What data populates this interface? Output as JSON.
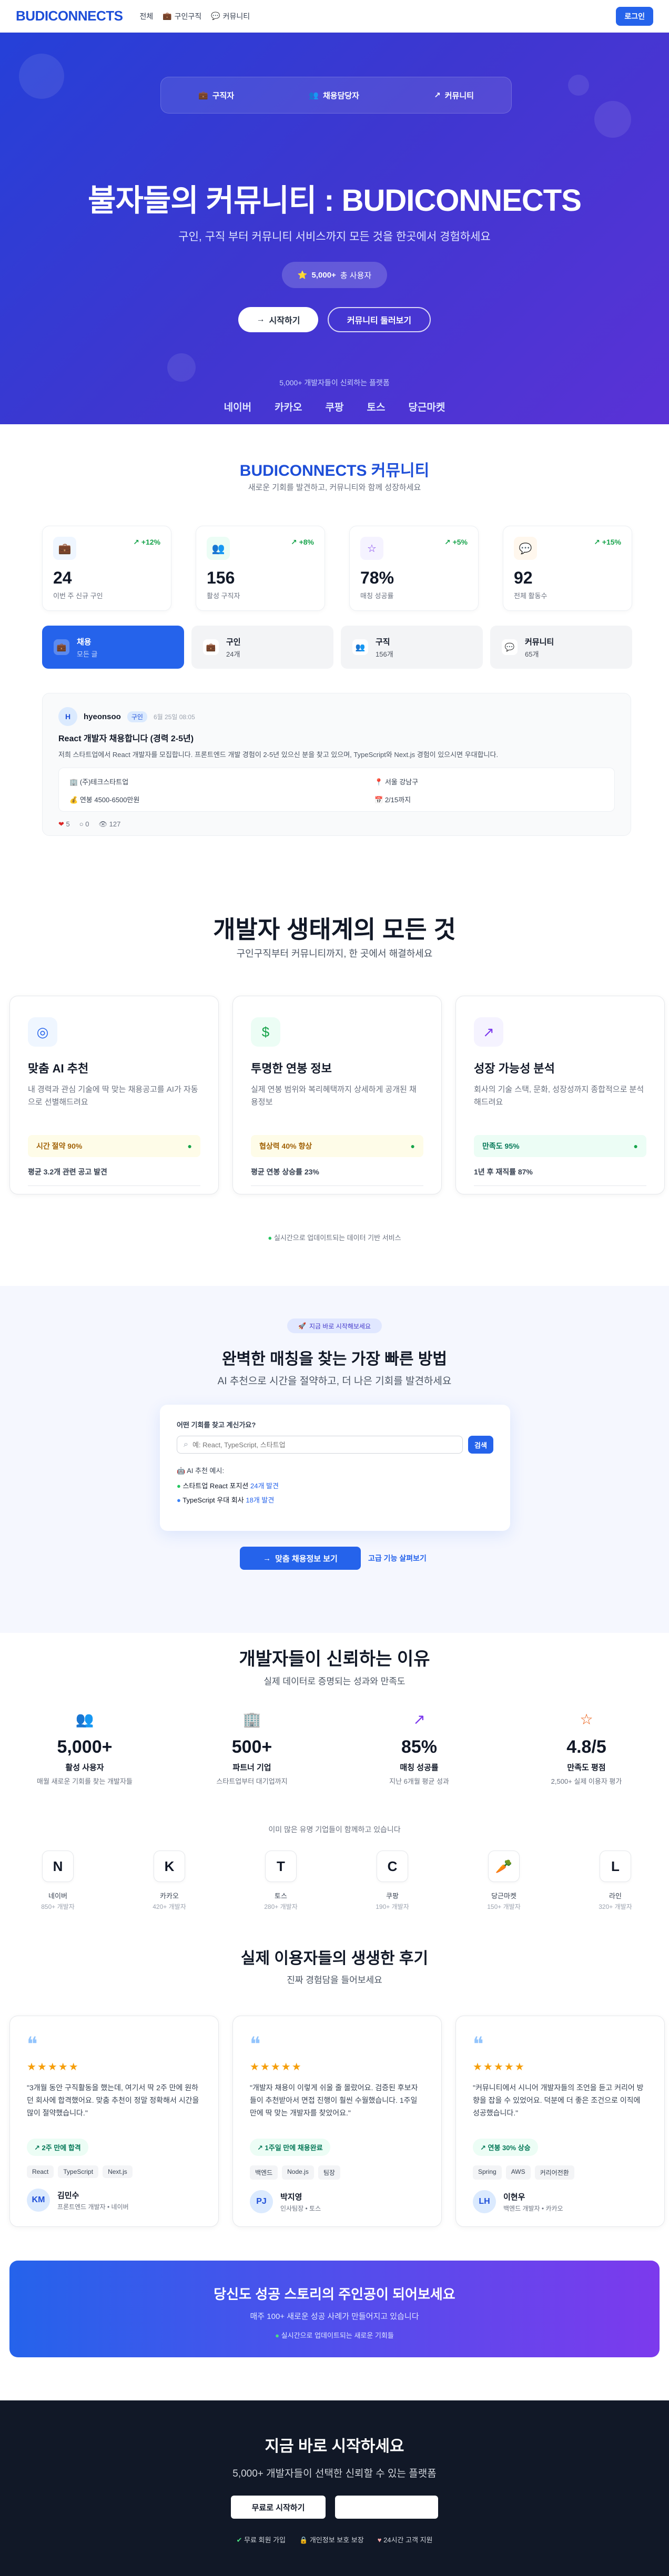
{
  "nav": {
    "logo": "BUDICONNECTS",
    "links": [
      "전체",
      "구인구직",
      "커뮤니티"
    ],
    "login": "로그인"
  },
  "hero": {
    "tabs": [
      "구직자",
      "채용담당자",
      "커뮤니티"
    ],
    "title": "불자들의 커뮤니티 : BUDICONNECTS",
    "subtitle": "구인, 구직 부터 커뮤니티 서비스까지 모든 것을 한곳에서 경험하세요",
    "user_count": "5,000+",
    "user_suffix": "총 사용자",
    "cta_primary": "시작하기",
    "cta_secondary": "커뮤니티 둘러보기",
    "trusted": "5,000+ 개발자들이 신뢰하는 플랫폼",
    "companies": [
      "네이버",
      "카카오",
      "쿠팡",
      "토스",
      "당근마켓"
    ]
  },
  "community": {
    "title": "BUDICONNECTS 커뮤니티",
    "subtitle": "새로운 기회를 발견하고, 커뮤니티와 함께 성장하세요",
    "stats": [
      {
        "icon": "briefcase-icon",
        "delta": "+12%",
        "value": "24",
        "label": "이번 주 신규 구인"
      },
      {
        "icon": "users-icon",
        "delta": "+8%",
        "value": "156",
        "label": "활성 구직자"
      },
      {
        "icon": "star-icon",
        "delta": "+5%",
        "value": "78%",
        "label": "매칭 성공률"
      },
      {
        "icon": "chat-icon",
        "delta": "+15%",
        "value": "92",
        "label": "전체 활동수"
      }
    ],
    "tabs": [
      {
        "label": "채용",
        "sub": "모든 글"
      },
      {
        "label": "구인",
        "sub": "24개"
      },
      {
        "label": "구직",
        "sub": "156개"
      },
      {
        "label": "커뮤니티",
        "sub": "65개"
      }
    ],
    "post": {
      "avatar": "H",
      "author": "hyeonsoo",
      "category": "구인",
      "date": "6월 25일 08:05",
      "title": "React 개발자 채용합니다 (경력 2-5년)",
      "body": "저희 스타트업에서 React 개발자를 모집합니다. 프론트엔드 개발 경험이 2-5년 있으신 분을 찾고 있으며, TypeScript와 Next.js 경험이 있으시면 우대합니다.",
      "company": "(주)테크스타트업",
      "location": "서울 강남구",
      "salary": "연봉 4500-6500만원",
      "deadline": "2/15까지",
      "likes": "5",
      "comments": "0",
      "views": "127"
    }
  },
  "features": {
    "title": "개발자 생태계의 모든 것",
    "subtitle": "구인구직부터 커뮤니티까지, 한 곳에서 해결하세요",
    "cards": [
      {
        "title": "맞춤 AI 추천",
        "desc": "내 경력과 관심 기술에 딱 맞는 채용공고를 AI가 자동으로 선별해드려요",
        "highlight": "시간 절약 90%",
        "summary": "평균 3.2개 관련 공고 발견"
      },
      {
        "title": "투명한 연봉 정보",
        "desc": "실제 연봉 범위와 복리혜택까지 상세하게 공개된 채용정보",
        "highlight": "협상력 40% 향상",
        "summary": "평균 연봉 상승률 23%"
      },
      {
        "title": "성장 가능성 분석",
        "desc": "회사의 기술 스택, 문화, 성장성까지 종합적으로 분석해드려요",
        "highlight": "만족도 95%",
        "summary": "1년 후 재직률 87%"
      }
    ],
    "note": "실시간으로 업데이트되는 데이터 기반 서비스"
  },
  "matching": {
    "badge": "지금 바로 시작해보세요",
    "title": "완벽한 매칭을 찾는 가장 빠른 방법",
    "subtitle": "AI 추천으로 시간을 절약하고, 더 나은 기회를 발견하세요",
    "search_label": "어떤 기회를 찾고 계신가요?",
    "search_placeholder": "예: React, TypeScript, 스타트업",
    "search_button": "검색",
    "ai_label": "AI 추천 예시:",
    "examples": [
      {
        "text": "스타트업 React 포지션",
        "count": "24개 발견"
      },
      {
        "text": "TypeScript 우대 회사",
        "count": "18개 발견"
      }
    ],
    "cta_primary": "맞춤 채용정보 보기",
    "cta_secondary": "고급 기능 살펴보기"
  },
  "trust": {
    "title": "개발자들이 신뢰하는 이유",
    "subtitle": "실제 데이터로 증명되는 성과와 만족도",
    "stats": [
      {
        "icon": "users-icon",
        "value": "5,000+",
        "label": "활성 사용자",
        "desc": "매월 새로운 기회를 찾는 개발자들"
      },
      {
        "icon": "building-icon",
        "value": "500+",
        "label": "파트너 기업",
        "desc": "스타트업부터 대기업까지"
      },
      {
        "icon": "trend-up-icon",
        "value": "85%",
        "label": "매칭 성공률",
        "desc": "지난 6개월 평균 성과"
      },
      {
        "icon": "star-icon",
        "value": "4.8/5",
        "label": "만족도 평점",
        "desc": "2,500+ 실제 이용자 평가"
      }
    ],
    "partners_title": "이미 많은 유명 기업들이 함께하고 있습니다",
    "partners": [
      {
        "letter": "N",
        "name": "네이버",
        "count": "850+ 개발자"
      },
      {
        "letter": "K",
        "name": "카카오",
        "count": "420+ 개발자"
      },
      {
        "letter": "T",
        "name": "토스",
        "count": "280+ 개발자"
      },
      {
        "letter": "C",
        "name": "쿠팡",
        "count": "190+ 개발자"
      },
      {
        "letter": "🥕",
        "name": "당근마켓",
        "count": "150+ 개발자"
      },
      {
        "letter": "L",
        "name": "라인",
        "count": "320+ 개발자"
      }
    ]
  },
  "reviews": {
    "title": "실제 이용자들의 생생한 후기",
    "subtitle": "진짜 경험담을 들어보세요",
    "items": [
      {
        "text": "\"3개월 동안 구직활동을 했는데, 여기서 딱 2주 만에 원하던 회사에 합격했어요. 맞춤 추천이 정말 정확해서 시간을 많이 절약했습니다.\"",
        "badge": "2주 만에 합격",
        "tags": [
          "React",
          "TypeScript",
          "Next.js"
        ],
        "initials": "KM",
        "name": "김민수",
        "role": "프론트엔드 개발자 • 네이버"
      },
      {
        "text": "\"개발자 채용이 이렇게 쉬울 줄 몰랐어요. 검증된 후보자들이 추천받아서 면접 진행이 훨씬 수월했습니다. 1주일 만에 딱 맞는 개발자를 찾았어요.\"",
        "badge": "1주일 만에 채용완료",
        "tags": [
          "백엔드",
          "Node.js",
          "팀장"
        ],
        "initials": "PJ",
        "name": "박지영",
        "role": "인사팀장 • 토스"
      },
      {
        "text": "\"커뮤니티에서 시니어 개발자들의 조언을 듣고 커리어 방향을 잡을 수 있었어요. 덕분에 더 좋은 조건으로 이직에 성공했습니다.\"",
        "badge": "연봉 30% 상승",
        "tags": [
          "Spring",
          "AWS",
          "커리어전환"
        ],
        "initials": "LH",
        "name": "이현우",
        "role": "백엔드 개발자 • 카카오"
      }
    ]
  },
  "banner": {
    "title": "당신도 성공 스토리의 주인공이 되어보세요",
    "subtitle": "매주 100+ 새로운 성공 사례가 만들어지고 있습니다",
    "note": "실시간으로 업데이트되는 새로운 기회들"
  },
  "footer": {
    "title": "지금 바로 시작하세요",
    "subtitle": "5,000+ 개발자들이 선택한 신뢰할 수 있는 플랫폼",
    "cta_primary": "무료로 시작하기",
    "features": [
      "무료 회원 가입",
      "개인정보 보호 보장",
      "24시간 고객 지원"
    ]
  },
  "colors": {
    "brand": "#2563eb",
    "hero_start": "#2540d8",
    "hero_end": "#5a32d6",
    "success": "#16a34a",
    "banner_start": "#2563eb",
    "banner_end": "#7c3aed",
    "footer_bg": "#111827"
  }
}
